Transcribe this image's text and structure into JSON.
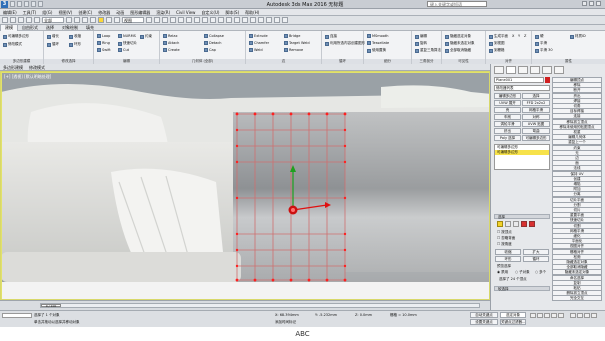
{
  "title_bar": {
    "app_title": "Autodesk 3ds Max 2016",
    "file_name": "无标题",
    "search_placeholder": "键入关键字或短语"
  },
  "menu_bar": {
    "items": [
      "编辑(E)",
      "工具(T)",
      "组(G)",
      "视图(V)",
      "创建(C)",
      "修改器",
      "动画",
      "图形编辑器",
      "渲染(R)",
      "Civil View",
      "自定义(U)",
      "脚本(S)",
      "帮助(H)"
    ]
  },
  "main_toolbar": {
    "selection_filter": "全部",
    "reference_coord": "视图"
  },
  "ribbon_tabs": {
    "items": [
      "建模",
      "自由形式",
      "选择",
      "对象绘制",
      "填充"
    ],
    "active": "建模"
  },
  "ribbon": {
    "groups": [
      {
        "title": "多边形建模",
        "items": [
          "可编辑多边形",
          "修改模式"
        ]
      },
      {
        "title": "修改选择",
        "items": [
          "增长",
          "收缩",
          "循环",
          "环形"
        ]
      },
      {
        "title": "编辑",
        "items": [
          "Loop",
          "Ring",
          "Swift",
          "NURMS",
          "快速切片",
          "Cut",
          "约束"
        ]
      },
      {
        "title": "几何体 (全部)",
        "items": [
          "Relax",
          "Attach",
          "Create",
          "Collapse",
          "Detach",
          "Cap"
        ]
      },
      {
        "title": "边",
        "items": [
          "Extrude",
          "Chamfer",
          "Weld",
          "Bridge",
          "Target Weld",
          "Remove"
        ]
      },
      {
        "title": "循环",
        "items": [
          "连接",
          "利用所选内容创建图形"
        ]
      },
      {
        "title": "细分",
        "items": [
          "MSmooth",
          "Tessellate",
          "使用置换"
        ]
      },
      {
        "title": "三角剖分",
        "items": [
          "编辑",
          "旋转",
          "重复三角算法"
        ]
      },
      {
        "title": "可见性",
        "items": [
          "隐藏选定对象",
          "隐藏未选定对象",
          "全部取消隐藏"
        ]
      },
      {
        "title": "对齐",
        "items": [
          "生成平面",
          "到视图",
          "到栅格",
          "X",
          "Y",
          "Z"
        ]
      },
      {
        "title": "属性",
        "items": [
          "硬",
          "平滑",
          "平滑 30",
          "材质ID"
        ]
      }
    ]
  },
  "sub_bar": {
    "items": [
      "多边形建模",
      "修改模式"
    ]
  },
  "viewport": {
    "label": "[+] [透视] [默认明暗处理]"
  },
  "command_panel": {
    "object_name": "Plane001",
    "modifier_list": "修改器列表",
    "buttons_top": [
      "编辑多边形",
      "选择",
      "UVW 展开",
      "FFD 2x2x2",
      "壳",
      "网格平滑",
      "车削",
      "对称",
      "涡轮平滑",
      "UVW 贴图",
      "挤出",
      "弯曲",
      "Poly 选择",
      "可编辑多边形"
    ],
    "stack_items": [
      "可编辑多边形",
      "可编辑多边形"
    ],
    "selection_head": "选择",
    "selection_options": [
      "按顶点",
      "忽略背面",
      "按角度",
      "收缩",
      "扩大",
      "环形",
      "循环"
    ],
    "preview_head": "预览选择",
    "preview_options": [
      "禁用",
      "子对象",
      "多个"
    ],
    "selected_count": "选择了 24 个顶点",
    "soft_selection_head": "软选择",
    "right_column": [
      "编辑顶点",
      "移除",
      "断开",
      "挤出",
      "焊接",
      "切角",
      "目标焊接",
      "连接",
      "移除孤立顶点",
      "移除未使用的贴图顶点",
      "权重",
      "编辑几何体",
      "重复上一个",
      "约束",
      "无",
      "边",
      "面",
      "法线",
      "保持 UV",
      "创建",
      "塌陷",
      "附加",
      "分离",
      "切片平面",
      "分割",
      "切片",
      "重置平面",
      "快速切片",
      "切割",
      "网格平滑",
      "细化",
      "平面化",
      "视图对齐",
      "栅格对齐",
      "松弛",
      "隐藏选定对象",
      "全部取消隐藏",
      "隐藏未选定对象",
      "命名选择",
      "复制",
      "粘贴",
      "删除孤立顶点",
      "完全交互"
    ],
    "threshold_value": "0.0"
  },
  "timeline": {
    "frame": "0 / 100"
  },
  "status": {
    "selected_text": "选择了 1 个对象",
    "prompt_text": "单击并拖动以选择并移动对象",
    "x_value": "68.394mm",
    "y_value": "-5.232mm",
    "z_value": "0.0mm",
    "grid_value": "栅格 = 10.0mm",
    "auto_key": "自动关键点",
    "set_key": "设置关键点",
    "selected_obj": "选定对象",
    "key_filters": "关键点过滤器...",
    "add_time_tag": "添加时间标记"
  },
  "caption": "ABC"
}
